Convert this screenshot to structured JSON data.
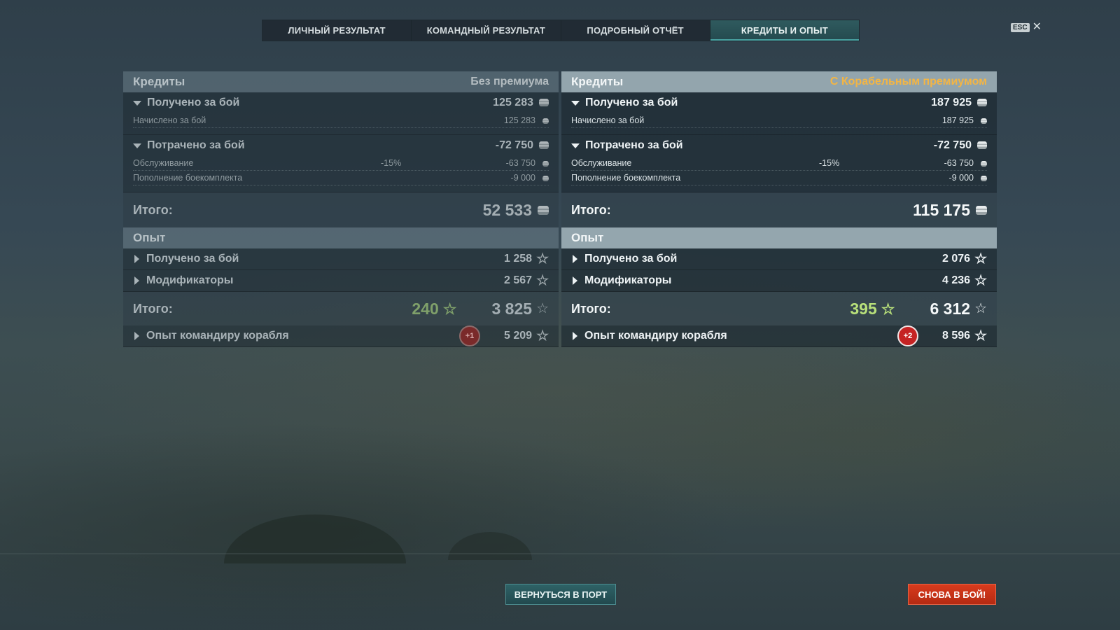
{
  "tabs": [
    "ЛИЧНЫЙ РЕЗУЛЬТАТ",
    "КОМАНДНЫЙ РЕЗУЛЬТАТ",
    "ПОДРОБНЫЙ ОТЧЁТ",
    "КРЕДИТЫ И ОПЫТ"
  ],
  "active_tab": "КРЕДИТЫ И ОПЫТ",
  "esc_label": "ESC",
  "close_symbol": "✕",
  "left": {
    "credits_title": "Кредиты",
    "mode_label": "Без премиума",
    "earned_label": "Получено за бой",
    "earned_value": "125 283",
    "accrued_label": "Начислено за бой",
    "accrued_value": "125 283",
    "spent_label": "Потрачено за бой",
    "spent_value": "-72 750",
    "service_label": "Обслуживание",
    "service_pct": "-15%",
    "service_value": "-63 750",
    "ammo_label": "Пополнение боекомплекта",
    "ammo_value": "-9 000",
    "credits_total_label": "Итого:",
    "credits_total_value": "52 533",
    "exp_title": "Опыт",
    "exp_earned_label": "Получено за бой",
    "exp_earned_value": "1 258",
    "modifiers_label": "Модификаторы",
    "modifiers_value": "2 567",
    "exp_total_label": "Итого:",
    "free_exp_value": "240",
    "exp_total_value": "3 825",
    "commander_label": "Опыт командиру корабля",
    "commander_badge": "+1",
    "commander_value": "5 209"
  },
  "right": {
    "credits_title": "Кредиты",
    "mode_label": "С Корабельным премиумом",
    "earned_label": "Получено за бой",
    "earned_value": "187 925",
    "accrued_label": "Начислено за бой",
    "accrued_value": "187 925",
    "spent_label": "Потрачено за бой",
    "spent_value": "-72 750",
    "service_label": "Обслуживание",
    "service_pct": "-15%",
    "service_value": "-63 750",
    "ammo_label": "Пополнение боекомплекта",
    "ammo_value": "-9 000",
    "credits_total_label": "Итого:",
    "credits_total_value": "115 175",
    "exp_title": "Опыт",
    "exp_earned_label": "Получено за бой",
    "exp_earned_value": "2 076",
    "modifiers_label": "Модификаторы",
    "modifiers_value": "4 236",
    "exp_total_label": "Итого:",
    "free_exp_value": "395",
    "exp_total_value": "6 312",
    "commander_label": "Опыт командиру корабля",
    "commander_badge": "+2",
    "commander_value": "8 596"
  },
  "buttons": {
    "return_port": "ВЕРНУТЬСЯ В ПОРТ",
    "battle_again": "СНОВА В БОЙ!"
  },
  "colors": {
    "premium_label": "#f3b544",
    "free_exp_green": "#b8e07a",
    "battle_button": "#c93217",
    "port_button": "#2a575b",
    "active_tab": "#2c5559"
  },
  "icons": [
    "credit-coin-icon",
    "experience-star-icon",
    "free-exp-star-icon",
    "expand-arrow-icon",
    "collapse-arrow-icon",
    "close-icon"
  ]
}
